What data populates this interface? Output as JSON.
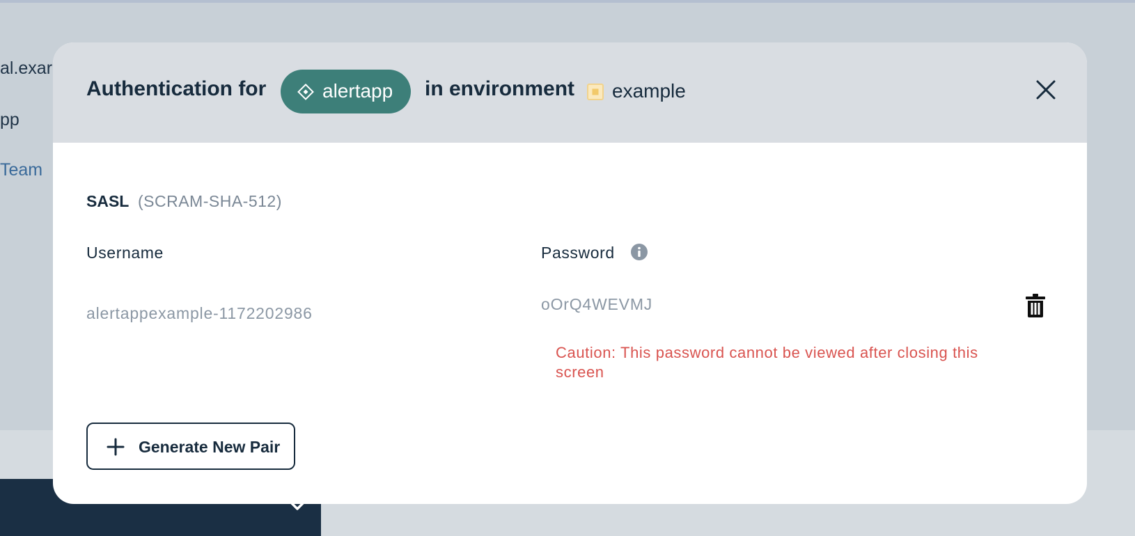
{
  "background": {
    "line1": "al.exar",
    "line2": "pp",
    "link": "Team"
  },
  "modal": {
    "title_prefix": "Authentication for",
    "app_name": "alertapp",
    "title_middle": "in environment",
    "environment_name": "example",
    "auth_type": "SASL",
    "mechanism": "(SCRAM-SHA-512)",
    "username_header": "Username",
    "password_header": "Password",
    "username_value": "alertappexample-1172202986",
    "password_value": "oOrQ4WEVMJ",
    "caution_text": "Caution: This password cannot be viewed after closing this screen",
    "generate_button_label": "Generate New Pair"
  },
  "icons": {
    "app": "diamond-icon",
    "environment": "environment-square-icon",
    "close": "close-icon",
    "info": "info-icon",
    "delete": "trash-icon",
    "add": "plus-icon",
    "background_expand": "chevron-down-icon"
  },
  "colors": {
    "app_pill": "#3d7f79",
    "environment_icon": "#f2d38c",
    "caution": "#d9534f",
    "primary_text": "#172b3d"
  }
}
